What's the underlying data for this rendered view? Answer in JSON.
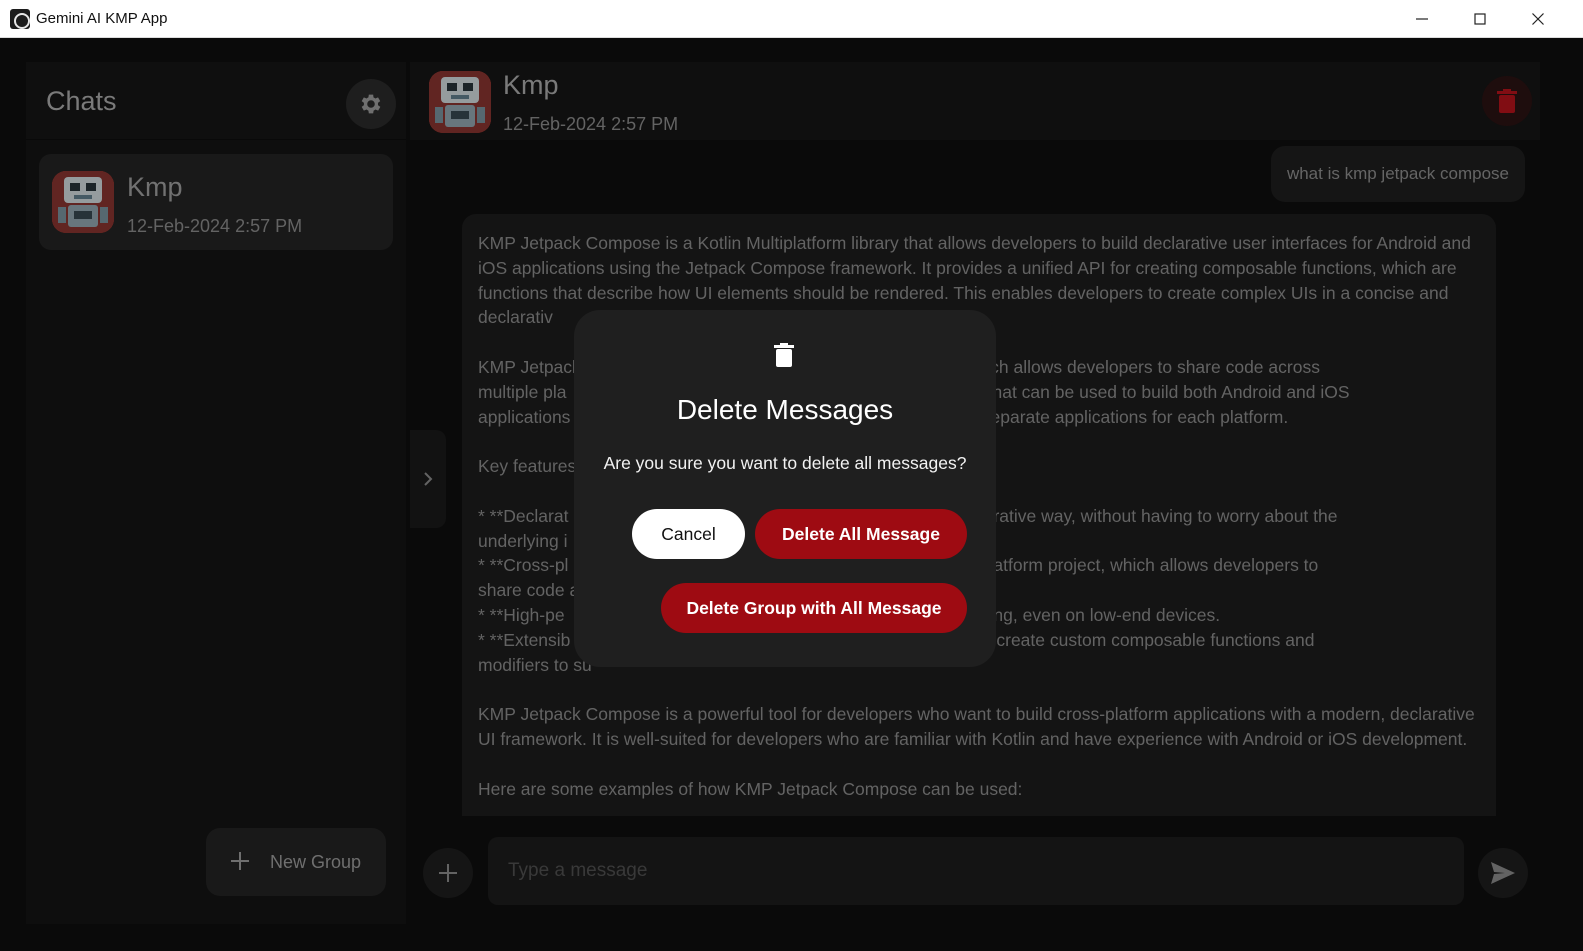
{
  "window": {
    "title": "Gemini AI KMP App",
    "controls": [
      "minimize-icon",
      "maximize-icon",
      "close-icon"
    ]
  },
  "sidebar": {
    "title": "Chats",
    "settings_icon": "gear-icon",
    "chats": [
      {
        "name": "Kmp",
        "date": "12-Feb-2024 2:57 PM"
      }
    ],
    "new_group_label": "New Group"
  },
  "chat": {
    "header": {
      "name": "Kmp",
      "date": "12-Feb-2024 2:57 PM",
      "delete_icon": "trash-icon"
    },
    "messages": [
      {
        "role": "user",
        "text": "what is kmp jetpack compose"
      },
      {
        "role": "model",
        "paragraphs": [
          "KMP Jetpack Compose is a Kotlin Multiplatform library that allows developers to build declarative user interfaces for Android and iOS applications using the Jetpack Compose framework. It provides a unified API for creating composable functions, which are functions that describe how UI elements should be rendered. This enables developers to create complex UIs in a concise and declarativ",
          "KMP Jetpacl",
          "multiple pla",
          "applications",
          "Key features",
          "* **Declarat",
          "underlying i",
          "* **Cross-pl",
          "share code a",
          "* **High-pe",
          "* **Extensib",
          "modifiers to su",
          "KMP Jetpack Compose is a powerful tool for developers who want to build cross-platform applications with a modern, declarative UI framework. It is well-suited for developers who are familiar with Kotlin and have experience with Android or iOS development.",
          "Here are some examples of how KMP Jetpack Compose can be used:"
        ]
      }
    ],
    "model_text": "KMP Jetpack Compose is a Kotlin Multiplatform library that allows developers to build declarative user interfaces for Android and iOS applications using the Jetpack Compose framework. It provides a unified API for creating composable functions, which are functions that describe how UI elements should be rendered. This enables developers to create complex UIs in a concise and declarativ                        ing implementation details.\n\nKMP Jetpacl                                                                   project, which allows developers to share code across\nmultiple pla                                                                   e codebase that can be used to build both Android and iOS\napplications                                                                   d maintain separate applications for each platform.\n\nKey features\n\n* **Declarat                                                                   se and declarative way, without having to worry about the\nunderlying i\n* **Cross-pl                                                                   Kotlin Multiplatform project, which allows developers to\nshare code a\n* **High-pe                                                                   high-performing, even on low-end devices.\n* **Extensib                                                                   evelopers to create custom composable functions and\nmodifiers to su\n\nKMP Jetpack Compose is a powerful tool for developers who want to build cross-platform applications with a modern, declarative UI framework. It is well-suited for developers who are familiar with Kotlin and have experience with Android or iOS development.\n\nHere are some examples of how KMP Jetpack Compose can be used:",
    "input_placeholder": "Type a message",
    "attach_icon": "plus-icon",
    "send_icon": "send-icon",
    "collapse_icon": "chevron-right-icon"
  },
  "dialog": {
    "icon": "trash-icon",
    "title": "Delete Messages",
    "text": "Are you sure you want to delete all messages?",
    "cancel_label": "Cancel",
    "delete_all_label": "Delete All Message",
    "delete_group_label": "Delete Group with All Message"
  },
  "colors": {
    "background": "#0e0e0e",
    "surface": "#1c1c1c",
    "danger": "#9e0b12",
    "delete_icon": "#b3121b",
    "text_muted": "#8a8a8a"
  }
}
